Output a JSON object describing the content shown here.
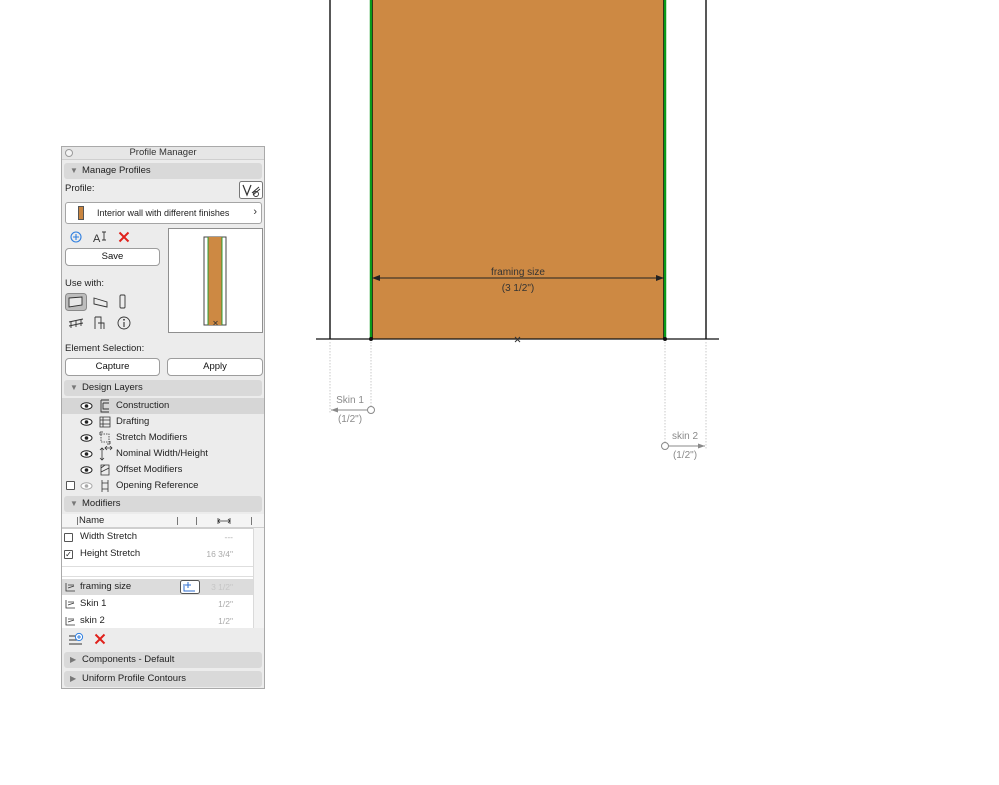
{
  "palette": {
    "title": "Profile Manager",
    "manage_profiles": {
      "header": "Manage Profiles",
      "profile_label": "Profile:",
      "profile_name": "Interior wall with different finishes",
      "save_label": "Save",
      "use_with_label": "Use with:"
    },
    "element_selection": {
      "label": "Element Selection:",
      "capture_label": "Capture",
      "apply_label": "Apply"
    },
    "design_layers": {
      "header": "Design Layers",
      "layers": [
        {
          "name": "Construction",
          "selected": true
        },
        {
          "name": "Drafting"
        },
        {
          "name": "Stretch Modifiers"
        },
        {
          "name": "Nominal Width/Height"
        },
        {
          "name": "Offset Modifiers"
        },
        {
          "name": "Opening Reference"
        }
      ]
    },
    "modifiers": {
      "header": "Modifiers",
      "column_name": "Name",
      "stretch_rows": [
        {
          "name": "Width Stretch",
          "checked": false,
          "value": "---"
        },
        {
          "name": "Height Stretch",
          "checked": true,
          "value": "16 3/4\""
        }
      ],
      "dimension_rows": [
        {
          "name": "framing size",
          "value": "3 1/2\""
        },
        {
          "name": "Skin 1",
          "value": "1/2\""
        },
        {
          "name": "skin 2",
          "value": "1/2\""
        }
      ]
    },
    "components_header": "Components - Default",
    "contours_header": "Uniform Profile Contours"
  },
  "drawing": {
    "dim_framing_name": "framing size",
    "dim_framing_value": "(3 1/2\")",
    "dim_skin1_name": "Skin 1",
    "dim_skin1_value": "(1/2\")",
    "dim_skin2_name": "skin 2",
    "dim_skin2_value": "(1/2\")"
  },
  "colors": {
    "core_fill": "#cd8943",
    "skin_line": "#0a9a1a",
    "panel_bg": "#ececec",
    "section_bg": "#d9d9d9",
    "delete_red": "#e0211b",
    "add_blue": "#2f7fe0"
  }
}
